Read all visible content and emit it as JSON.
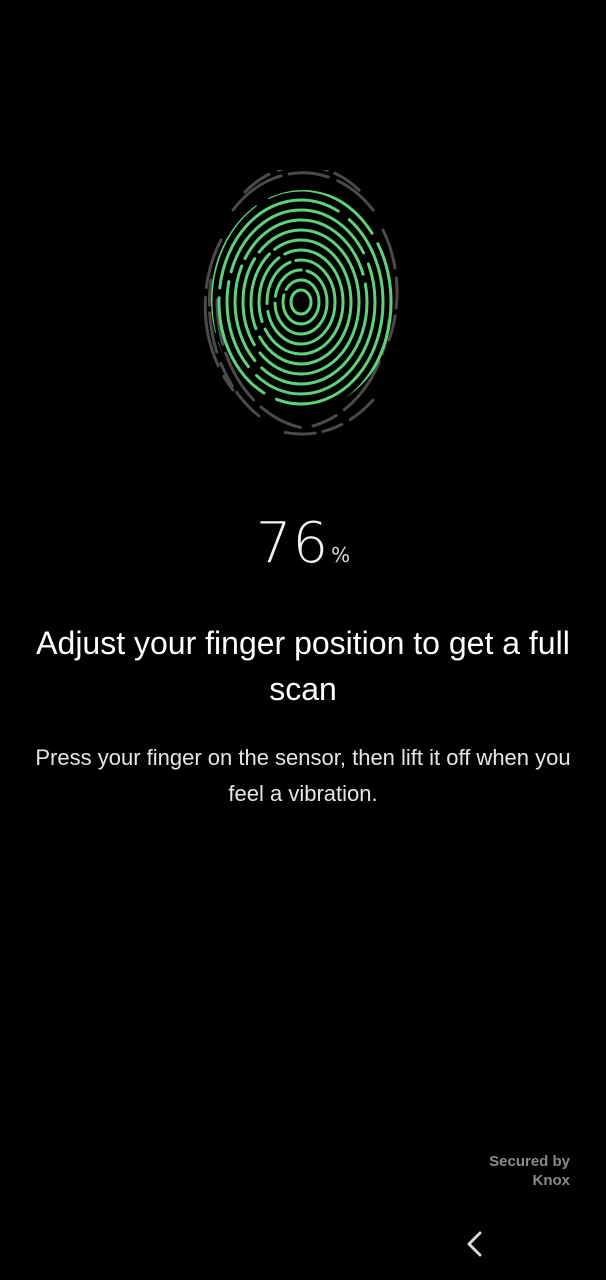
{
  "enrollment": {
    "progress_value": "76",
    "progress_unit": "%",
    "progress_percent": 76,
    "title": "Adjust your finger position to get a full scan",
    "description": "Press your finger on the sensor, then lift it off when you feel a vibration."
  },
  "footer": {
    "secured_line1": "Secured by",
    "secured_line2": "Knox"
  },
  "navigation": {
    "back_icon": "chevron-left-icon"
  },
  "icons": {
    "fingerprint": "fingerprint-icon"
  },
  "colors": {
    "background": "#000000",
    "scanned_ridge": "#5fd17a",
    "unscanned_ridge": "#4a4a4a",
    "text_primary": "#ffffff",
    "text_secondary": "#e6e6e6",
    "text_muted": "#8a8a8a"
  }
}
